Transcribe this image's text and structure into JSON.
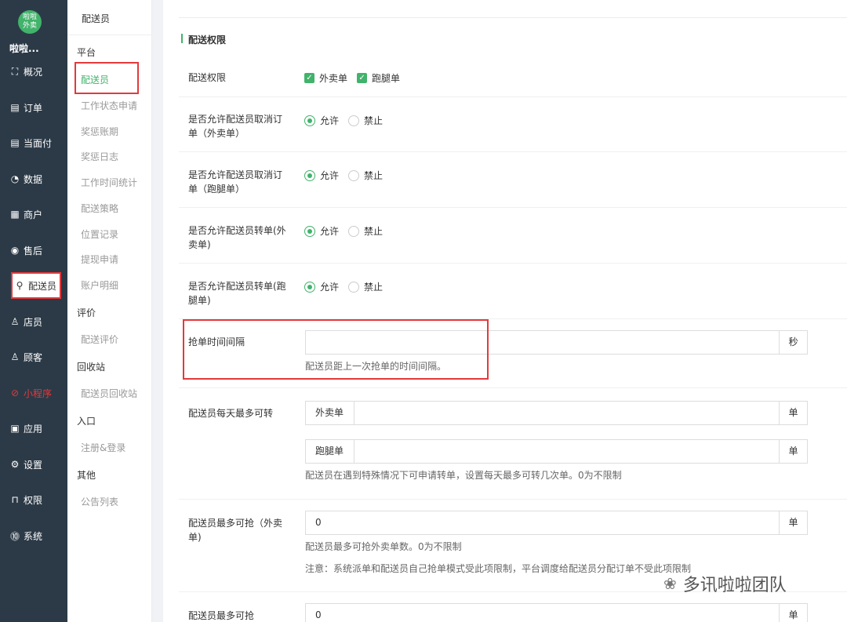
{
  "sidebar": {
    "logo_top": "啦啦",
    "logo_bottom": "外卖",
    "store_name": "啦啦...",
    "items": [
      {
        "label": "概况",
        "icon": "⛶"
      },
      {
        "label": "订单",
        "icon": "▤"
      },
      {
        "label": "当面付",
        "icon": "▤"
      },
      {
        "label": "数据",
        "icon": "◔"
      },
      {
        "label": "商户",
        "icon": "▦"
      },
      {
        "label": "售后",
        "icon": "◉"
      },
      {
        "label": "配送员",
        "icon": "⚲"
      },
      {
        "label": "店员",
        "icon": "♙"
      },
      {
        "label": "顾客",
        "icon": "♙"
      },
      {
        "label": "小程序",
        "icon": "⊘"
      },
      {
        "label": "应用",
        "icon": "▣"
      },
      {
        "label": "设置",
        "icon": "⚙"
      },
      {
        "label": "权限",
        "icon": "⊓"
      },
      {
        "label": "系统",
        "icon": "⓾"
      }
    ]
  },
  "subnav": {
    "title": "配送员",
    "groups": {
      "platform": "平台",
      "review": "评价",
      "recycle": "回收站",
      "entry": "入口",
      "other": "其他"
    },
    "links": {
      "courier": "配送员",
      "work_status": "工作状态申请",
      "reward_account": "奖惩账期",
      "reward_log": "奖惩日志",
      "work_time": "工作时间统计",
      "strategy": "配送策略",
      "location": "位置记录",
      "withdraw": "提现申请",
      "account_detail": "账户明细",
      "courier_review": "配送评价",
      "courier_recycle": "配送员回收站",
      "register": "注册&登录",
      "notice": "公告列表"
    }
  },
  "main": {
    "section_title": "配送权限",
    "perm": {
      "label": "配送权限",
      "opt1": "外卖单",
      "opt2": "跑腿单"
    },
    "allow": "允许",
    "deny": "禁止",
    "rows": {
      "cancel_takeout": "是否允许配送员取消订单（外卖单）",
      "cancel_errand": "是否允许配送员取消订单（跑腿单）",
      "transfer_takeout": "是否允许配送员转单(外卖单)",
      "transfer_errand": "是否允许配送员转单(跑腿单)"
    },
    "grab_interval": {
      "label": "抢单时间间隔",
      "value": "",
      "suffix": "秒",
      "help": "配送员距上一次抢单的时间间隔。"
    },
    "daily_transfer": {
      "label": "配送员每天最多可转",
      "pre1": "外卖单",
      "pre2": "跑腿单",
      "suffix": "单",
      "help": "配送员在遇到特殊情况下可申请转单，设置每天最多可转几次单。0为不限制"
    },
    "max_grab_takeout": {
      "label": "配送员最多可抢（外卖单)",
      "value": "0",
      "suffix": "单",
      "help": "配送员最多可抢外卖单数。0为不限制",
      "note": "注意：系统派单和配送员自己抢单模式受此项限制，平台调度给配送员分配订单不受此项限制"
    },
    "max_grab_next": {
      "label": "配送员最多可抢",
      "value": "0",
      "suffix": "单"
    }
  },
  "watermark": "多讯啦啦团队",
  "colors": {
    "accent": "#41b36b",
    "highlight": "#e4393c",
    "sidebar": "#2c3a47"
  }
}
